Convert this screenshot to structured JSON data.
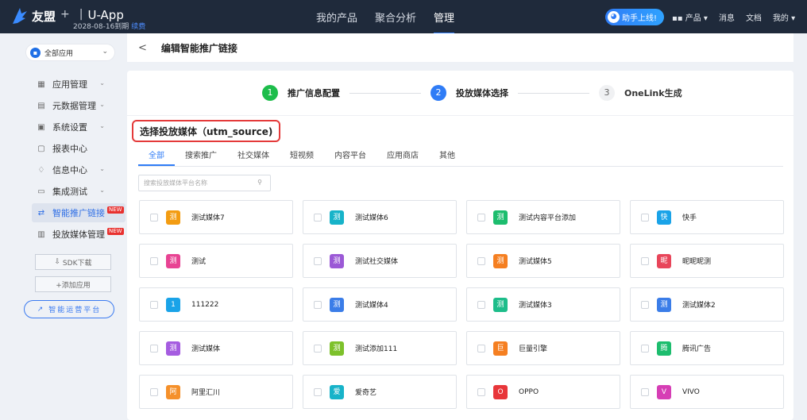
{
  "topbar": {
    "brand": "友盟",
    "plus": "+",
    "sep": "|",
    "app_name": "U-App",
    "expiry": "2028-08-16到期",
    "renew": "续费",
    "nav": [
      "我的产品",
      "聚合分析",
      "管理"
    ],
    "helper": "助手上线!",
    "products": "产品 ▾",
    "messages": "消息",
    "docs": "文档",
    "mine": "我的 ▾"
  },
  "sidebar": {
    "app_select": "全部应用",
    "menu": [
      {
        "label": "应用管理",
        "icon": "grid-icon",
        "chev": "⌄",
        "new": ""
      },
      {
        "label": "元数据管理",
        "icon": "database-icon",
        "chev": "⌄",
        "new": ""
      },
      {
        "label": "系统设置",
        "icon": "settings-icon",
        "chev": "⌄",
        "new": ""
      },
      {
        "label": "报表中心",
        "icon": "report-icon",
        "chev": "",
        "new": ""
      },
      {
        "label": "信息中心",
        "icon": "bell-icon",
        "chev": "⌄",
        "new": ""
      },
      {
        "label": "集成测试",
        "icon": "monitor-icon",
        "chev": "⌄",
        "new": ""
      },
      {
        "label": "智能推广链接",
        "icon": "link-icon",
        "chev": "",
        "new": "NEW"
      },
      {
        "label": "投放媒体管理",
        "icon": "media-icon",
        "chev": "",
        "new": "NEW"
      }
    ],
    "sdk_download": "SDK下载",
    "add_app": "+添加应用",
    "ops_platform": "智能运营平台"
  },
  "page": {
    "back": "<",
    "title": "编辑智能推广链接"
  },
  "steps": [
    {
      "num": "1",
      "label": "推广信息配置",
      "state": "done"
    },
    {
      "num": "2",
      "label": "投放媒体选择",
      "state": "cur"
    },
    {
      "num": "3",
      "label": "OneLink生成",
      "state": "todo"
    }
  ],
  "section_title": "选择投放媒体（utm_source)",
  "tabs": [
    "全部",
    "搜索推广",
    "社交媒体",
    "短视频",
    "内容平台",
    "应用商店",
    "其他"
  ],
  "search_placeholder": "搜索投放媒体平台名称",
  "media": [
    {
      "badge": "测",
      "name": "测试媒体7",
      "color": "#f39c12"
    },
    {
      "badge": "测",
      "name": "测试媒体6",
      "color": "#17b3c9"
    },
    {
      "badge": "测",
      "name": "测试内容平台添加",
      "color": "#1dbd6e"
    },
    {
      "badge": "快",
      "name": "快手",
      "color": "#1aa3e8"
    },
    {
      "badge": "测",
      "name": "测试",
      "color": "#e84393"
    },
    {
      "badge": "测",
      "name": "测试社交媒体",
      "color": "#9b59d6"
    },
    {
      "badge": "测",
      "name": "测试媒体5",
      "color": "#f57f21"
    },
    {
      "badge": "昵",
      "name": "昵昵昵测",
      "color": "#e8455a"
    },
    {
      "badge": "1",
      "name": "111222",
      "color": "#1aa3e8"
    },
    {
      "badge": "测",
      "name": "测试媒体4",
      "color": "#3b7de8"
    },
    {
      "badge": "测",
      "name": "测试媒体3",
      "color": "#1dbd8a"
    },
    {
      "badge": "测",
      "name": "测试媒体2",
      "color": "#3b7de8"
    },
    {
      "badge": "测",
      "name": "测试媒体",
      "color": "#a55ce0"
    },
    {
      "badge": "测",
      "name": "测试添加111",
      "color": "#7dc12b"
    },
    {
      "badge": "巨",
      "name": "巨量引擎",
      "color": "#f57f21"
    },
    {
      "badge": "腾",
      "name": "腾讯广告",
      "color": "#1dbd6e"
    },
    {
      "badge": "阿",
      "name": "阿里汇川",
      "color": "#f5902a"
    },
    {
      "badge": "爱",
      "name": "爱奇艺",
      "color": "#17b3c9"
    },
    {
      "badge": "O",
      "name": "OPPO",
      "color": "#e8363a"
    },
    {
      "badge": "V",
      "name": "VIVO",
      "color": "#d63eb5"
    }
  ]
}
